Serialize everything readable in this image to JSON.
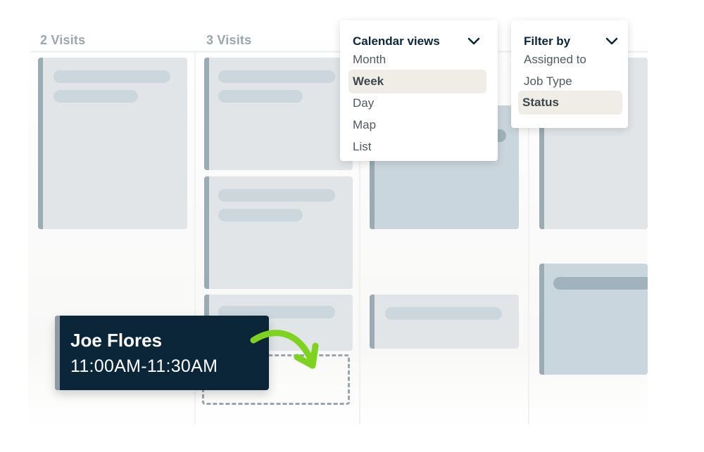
{
  "calendar": {
    "columns": [
      {
        "header": "2 Visits"
      },
      {
        "header": "3 Visits"
      },
      {
        "header": ""
      },
      {
        "header": ""
      }
    ]
  },
  "drag_card": {
    "name": "Joe Flores",
    "time": "11:00AM-11:30AM"
  },
  "colors": {
    "drag_card_bg": "#0b2638",
    "arrow": "#7ed321",
    "selected_item_bg": "#efede5",
    "card_gray": "#e1e5e8",
    "card_blue": "#cad6dd",
    "card_accent": "#9aabb3"
  },
  "calendar_views_menu": {
    "title": "Calendar views",
    "icon": "chevron-down-icon",
    "items": [
      {
        "label": "Month",
        "selected": false
      },
      {
        "label": "Week",
        "selected": true
      },
      {
        "label": "Day",
        "selected": false
      },
      {
        "label": "Map",
        "selected": false
      },
      {
        "label": "List",
        "selected": false
      }
    ]
  },
  "filter_menu": {
    "title": "Filter by",
    "icon": "chevron-down-icon",
    "items": [
      {
        "label": "Assigned to",
        "selected": false
      },
      {
        "label": "Job Type",
        "selected": false
      },
      {
        "label": "Status",
        "selected": true
      }
    ]
  }
}
